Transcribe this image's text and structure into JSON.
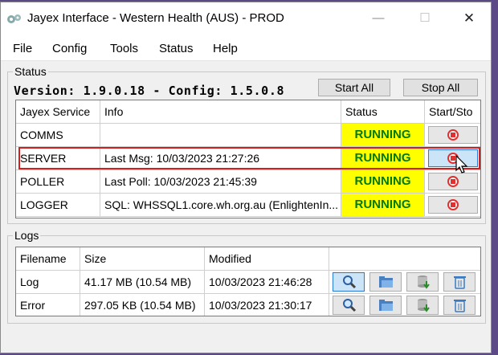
{
  "window": {
    "title": "Jayex Interface - Western Health (AUS) - PROD"
  },
  "menu": {
    "file": "File",
    "config": "Config",
    "tools": "Tools",
    "status": "Status",
    "help": "Help"
  },
  "status_group": {
    "title": "Status",
    "version_text": "Version: 1.9.0.18 - Config: 1.5.0.8",
    "start_all": "Start All",
    "stop_all": "Stop All",
    "columns": {
      "service": "Jayex Service",
      "info": "Info",
      "status": "Status",
      "start_stop": "Start/Sto"
    },
    "rows": [
      {
        "service": "COMMS",
        "info": "",
        "status": "RUNNING"
      },
      {
        "service": "SERVER",
        "info": "Last Msg: 10/03/2023 21:27:26",
        "status": "RUNNING"
      },
      {
        "service": "POLLER",
        "info": "Last Poll: 10/03/2023 21:45:39",
        "status": "RUNNING"
      },
      {
        "service": "LOGGER",
        "info": "SQL: WHSSQL1.core.wh.org.au (EnlightenIn...",
        "status": "RUNNING"
      }
    ]
  },
  "logs_group": {
    "title": "Logs",
    "columns": {
      "filename": "Filename",
      "size": "Size",
      "modified": "Modified"
    },
    "rows": [
      {
        "filename": "Log",
        "size": "41.17 MB (10.54 MB)",
        "modified": "10/03/2023 21:46:28"
      },
      {
        "filename": "Error",
        "size": "297.05 KB (10.54 MB)",
        "modified": "10/03/2023 21:30:17"
      }
    ],
    "action_icons": [
      "view-icon",
      "open-folder-icon",
      "download-icon",
      "trash-icon"
    ]
  },
  "colors": {
    "running_bg": "#ffff00",
    "running_text": "#007a00",
    "highlight": "#d21e1e",
    "stop_icon": "#e03030"
  }
}
